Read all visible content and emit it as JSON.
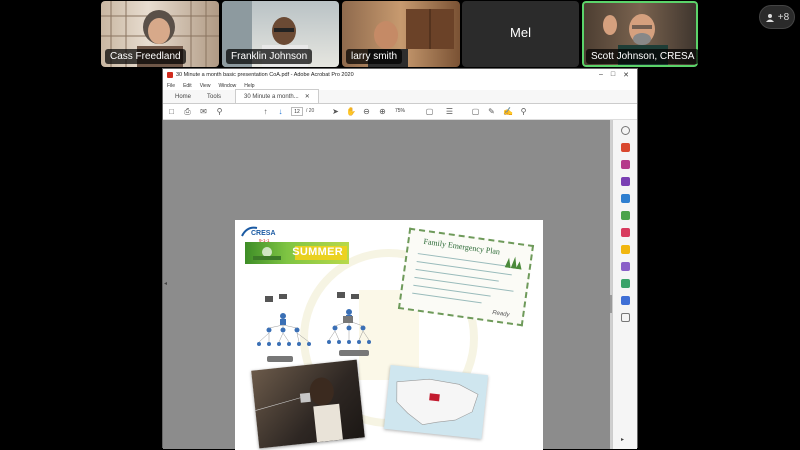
{
  "participants": [
    {
      "name": "Cass Freedland"
    },
    {
      "name": "Franklin Johnson"
    },
    {
      "name": "larry smith"
    },
    {
      "name": "Mel",
      "video_off": true
    },
    {
      "name": "Scott Johnson, CRESA",
      "active_speaker": true
    }
  ],
  "more_participants": "+8",
  "acrobat": {
    "window_title": "30 Minute a month basic presentation CoA.pdf - Adobe Acrobat Pro 2020",
    "menu": [
      "File",
      "Edit",
      "View",
      "Window",
      "Help"
    ],
    "tabs": [
      "Home",
      "Tools"
    ],
    "doc_tab": "30 Minute a month...",
    "page_current": "12",
    "page_total": "/  20",
    "zoom": "75%"
  },
  "slide": {
    "logo_text": "CRESA",
    "logo_sub": "9-1-1",
    "banner_text": "SUMMER",
    "plan_title": "Family Emergency Plan",
    "ready_text": "Ready"
  },
  "colors": {
    "active_speaker": "#5bd46a",
    "pdf_icon": "#d12b1e",
    "viewer_bg": "#8c8c8c"
  }
}
